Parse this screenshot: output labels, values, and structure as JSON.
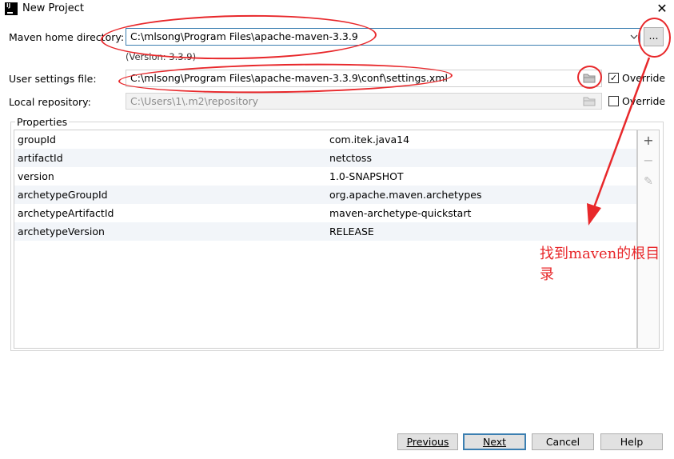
{
  "window": {
    "title": "New Project",
    "close_label": "✕"
  },
  "form": {
    "maven_home": {
      "label": "Maven home directory:",
      "value": "C:\\mlsong\\Program Files\\apache-maven-3.3.9",
      "browse_label": "...",
      "version_text": "(Version: 3.3.9)"
    },
    "user_settings": {
      "label": "User settings file:",
      "value": "C:\\mlsong\\Program Files\\apache-maven-3.3.9\\conf\\settings.xml",
      "override_label": "Override",
      "override_checked": true
    },
    "local_repo": {
      "label": "Local repository:",
      "value": "C:\\Users\\1\\.m2\\repository",
      "override_label": "Override",
      "override_checked": false
    }
  },
  "properties": {
    "title": "Properties",
    "rows": [
      {
        "key": "groupId",
        "value": "com.itek.java14"
      },
      {
        "key": "artifactId",
        "value": "netctoss"
      },
      {
        "key": "version",
        "value": "1.0-SNAPSHOT"
      },
      {
        "key": "archetypeGroupId",
        "value": "org.apache.maven.archetypes"
      },
      {
        "key": "archetypeArtifactId",
        "value": "maven-archetype-quickstart"
      },
      {
        "key": "archetypeVersion",
        "value": "RELEASE"
      }
    ],
    "tools": {
      "add": "+",
      "remove": "−",
      "edit": "✎"
    }
  },
  "annotation": {
    "note": "找到maven的根目录",
    "color": "#e8282b"
  },
  "buttons": {
    "previous": "Previous",
    "next": "Next",
    "cancel": "Cancel",
    "help": "Help"
  },
  "icons": [
    "intellij-idea-icon",
    "close-icon",
    "dropdown-arrow-icon",
    "folder-icon",
    "checkbox-icon",
    "plus-icon",
    "minus-icon",
    "pencil-icon"
  ]
}
